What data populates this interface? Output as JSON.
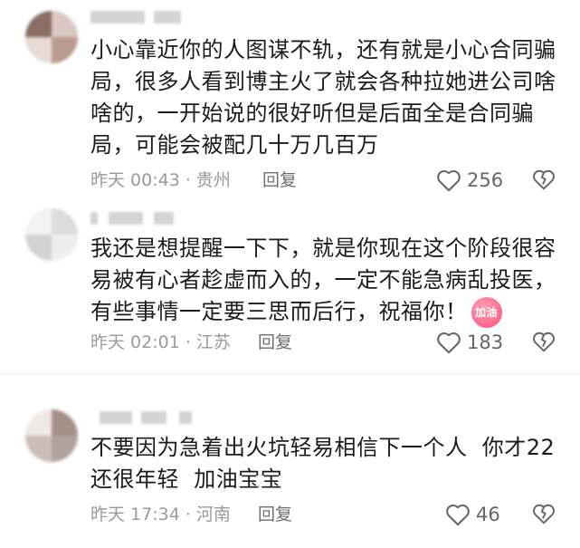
{
  "comments": [
    {
      "text": "小心靠近你的人图谋不轨，还有就是小心合同骗局，很多人看到博主火了就会各种拉她进公司啥啥的，一开始说的很好听但是后面全是合同骗局，可能会被配几十万几百万",
      "time": "昨天 00:43 · 贵州",
      "reply": "回复",
      "likes": "256"
    },
    {
      "text": "我还是想提醒一下下，就是你现在这个阶段很容易被有心者趁虚而入的，一定不能急病乱投医，有些事情一定要三思而后行，祝福你！",
      "emoji_label": "加油",
      "time": "昨天 02:01 · 江苏",
      "reply": "回复",
      "likes": "183"
    },
    {
      "text": "不要因为急着出火坑轻易相信下一个人  你才22  还很年轻  加油宝宝",
      "time": "昨天 17:34 · 河南",
      "reply": "回复",
      "likes": "46"
    }
  ],
  "colors": {
    "text": "#1b1b1b",
    "meta": "#9a9a9a",
    "divider": "#f0f0f0"
  },
  "icons": {
    "like": "heart-outline-icon",
    "dislike": "broken-heart-icon"
  }
}
